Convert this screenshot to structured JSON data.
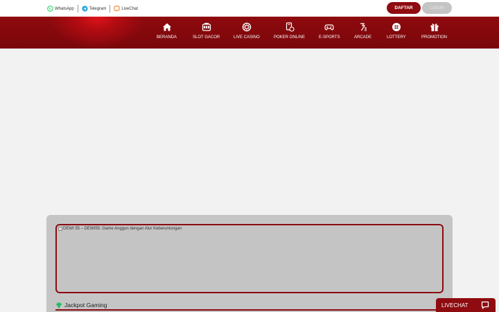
{
  "topbar": {
    "contacts": [
      {
        "label": "WhatsApp",
        "icon": "whatsapp-icon",
        "color": "#25d366"
      },
      {
        "label": "Telegram",
        "icon": "telegram-icon",
        "color": "#2ca5e0"
      },
      {
        "label": "LiveChat",
        "icon": "livechat-icon",
        "color": "#f47b20"
      }
    ],
    "daftar_label": "DAFTAR",
    "login_label": "LOGIN"
  },
  "nav": {
    "items": [
      {
        "label": "BERANDA",
        "icon": "home-icon"
      },
      {
        "label": "SLOT GACOR",
        "icon": "slot-machine-icon"
      },
      {
        "label": "LIVE CASINO",
        "icon": "roulette-icon"
      },
      {
        "label": "POKER ONLINE",
        "icon": "poker-cards-icon"
      },
      {
        "label": "E-SPORTS",
        "icon": "gamepad-icon"
      },
      {
        "label": "ARCADE",
        "icon": "arcade-icon"
      },
      {
        "label": "LOTTERY",
        "icon": "lottery-ball-icon"
      },
      {
        "label": "PROMOTION",
        "icon": "gift-icon"
      }
    ]
  },
  "content": {
    "banner_alt": "DEWI 55 – DEWI55: Game Anggun dengan Alur Keberuntungan",
    "jackpot_title": "Jackpot Gaming"
  },
  "livechat": {
    "label": "LIVECHAT"
  },
  "colors": {
    "brand": "#8e0b10",
    "panel": "#c5c5c5",
    "page": "#f2f2f2"
  }
}
